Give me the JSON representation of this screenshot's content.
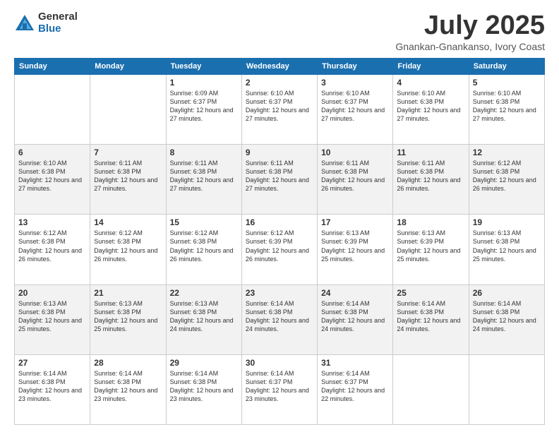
{
  "logo": {
    "general": "General",
    "blue": "Blue"
  },
  "title": {
    "month_year": "July 2025",
    "location": "Gnankan-Gnankanso, Ivory Coast"
  },
  "days_of_week": [
    "Sunday",
    "Monday",
    "Tuesday",
    "Wednesday",
    "Thursday",
    "Friday",
    "Saturday"
  ],
  "weeks": [
    [
      {
        "date": "",
        "info": ""
      },
      {
        "date": "",
        "info": ""
      },
      {
        "date": "1",
        "info": "Sunrise: 6:09 AM\nSunset: 6:37 PM\nDaylight: 12 hours and 27 minutes."
      },
      {
        "date": "2",
        "info": "Sunrise: 6:10 AM\nSunset: 6:37 PM\nDaylight: 12 hours and 27 minutes."
      },
      {
        "date": "3",
        "info": "Sunrise: 6:10 AM\nSunset: 6:37 PM\nDaylight: 12 hours and 27 minutes."
      },
      {
        "date": "4",
        "info": "Sunrise: 6:10 AM\nSunset: 6:38 PM\nDaylight: 12 hours and 27 minutes."
      },
      {
        "date": "5",
        "info": "Sunrise: 6:10 AM\nSunset: 6:38 PM\nDaylight: 12 hours and 27 minutes."
      }
    ],
    [
      {
        "date": "6",
        "info": "Sunrise: 6:10 AM\nSunset: 6:38 PM\nDaylight: 12 hours and 27 minutes."
      },
      {
        "date": "7",
        "info": "Sunrise: 6:11 AM\nSunset: 6:38 PM\nDaylight: 12 hours and 27 minutes."
      },
      {
        "date": "8",
        "info": "Sunrise: 6:11 AM\nSunset: 6:38 PM\nDaylight: 12 hours and 27 minutes."
      },
      {
        "date": "9",
        "info": "Sunrise: 6:11 AM\nSunset: 6:38 PM\nDaylight: 12 hours and 27 minutes."
      },
      {
        "date": "10",
        "info": "Sunrise: 6:11 AM\nSunset: 6:38 PM\nDaylight: 12 hours and 26 minutes."
      },
      {
        "date": "11",
        "info": "Sunrise: 6:11 AM\nSunset: 6:38 PM\nDaylight: 12 hours and 26 minutes."
      },
      {
        "date": "12",
        "info": "Sunrise: 6:12 AM\nSunset: 6:38 PM\nDaylight: 12 hours and 26 minutes."
      }
    ],
    [
      {
        "date": "13",
        "info": "Sunrise: 6:12 AM\nSunset: 6:38 PM\nDaylight: 12 hours and 26 minutes."
      },
      {
        "date": "14",
        "info": "Sunrise: 6:12 AM\nSunset: 6:38 PM\nDaylight: 12 hours and 26 minutes."
      },
      {
        "date": "15",
        "info": "Sunrise: 6:12 AM\nSunset: 6:38 PM\nDaylight: 12 hours and 26 minutes."
      },
      {
        "date": "16",
        "info": "Sunrise: 6:12 AM\nSunset: 6:39 PM\nDaylight: 12 hours and 26 minutes."
      },
      {
        "date": "17",
        "info": "Sunrise: 6:13 AM\nSunset: 6:39 PM\nDaylight: 12 hours and 25 minutes."
      },
      {
        "date": "18",
        "info": "Sunrise: 6:13 AM\nSunset: 6:39 PM\nDaylight: 12 hours and 25 minutes."
      },
      {
        "date": "19",
        "info": "Sunrise: 6:13 AM\nSunset: 6:38 PM\nDaylight: 12 hours and 25 minutes."
      }
    ],
    [
      {
        "date": "20",
        "info": "Sunrise: 6:13 AM\nSunset: 6:38 PM\nDaylight: 12 hours and 25 minutes."
      },
      {
        "date": "21",
        "info": "Sunrise: 6:13 AM\nSunset: 6:38 PM\nDaylight: 12 hours and 25 minutes."
      },
      {
        "date": "22",
        "info": "Sunrise: 6:13 AM\nSunset: 6:38 PM\nDaylight: 12 hours and 24 minutes."
      },
      {
        "date": "23",
        "info": "Sunrise: 6:14 AM\nSunset: 6:38 PM\nDaylight: 12 hours and 24 minutes."
      },
      {
        "date": "24",
        "info": "Sunrise: 6:14 AM\nSunset: 6:38 PM\nDaylight: 12 hours and 24 minutes."
      },
      {
        "date": "25",
        "info": "Sunrise: 6:14 AM\nSunset: 6:38 PM\nDaylight: 12 hours and 24 minutes."
      },
      {
        "date": "26",
        "info": "Sunrise: 6:14 AM\nSunset: 6:38 PM\nDaylight: 12 hours and 24 minutes."
      }
    ],
    [
      {
        "date": "27",
        "info": "Sunrise: 6:14 AM\nSunset: 6:38 PM\nDaylight: 12 hours and 23 minutes."
      },
      {
        "date": "28",
        "info": "Sunrise: 6:14 AM\nSunset: 6:38 PM\nDaylight: 12 hours and 23 minutes."
      },
      {
        "date": "29",
        "info": "Sunrise: 6:14 AM\nSunset: 6:38 PM\nDaylight: 12 hours and 23 minutes."
      },
      {
        "date": "30",
        "info": "Sunrise: 6:14 AM\nSunset: 6:37 PM\nDaylight: 12 hours and 23 minutes."
      },
      {
        "date": "31",
        "info": "Sunrise: 6:14 AM\nSunset: 6:37 PM\nDaylight: 12 hours and 22 minutes."
      },
      {
        "date": "",
        "info": ""
      },
      {
        "date": "",
        "info": ""
      }
    ]
  ]
}
